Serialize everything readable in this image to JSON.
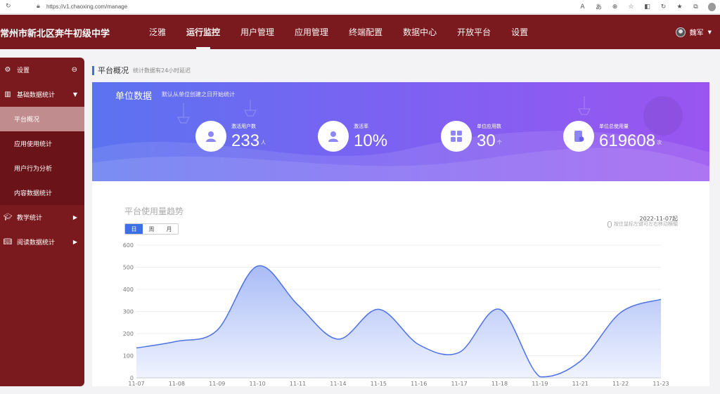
{
  "browser": {
    "url": "https://v1.chaoxing.com/manage",
    "avatar_initial": ""
  },
  "header": {
    "school_name": "常州市新北区奔牛初级中学",
    "nav": [
      "泛雅",
      "运行监控",
      "用户管理",
      "应用管理",
      "终端配置",
      "数据中心",
      "开放平台",
      "设置"
    ],
    "active_nav": "运行监控",
    "user_name": "魏军"
  },
  "sidebar": {
    "settings_label": "设置",
    "basic_stats_label": "基础数据统计",
    "sub_items": [
      "平台概况",
      "应用使用统计",
      "用户行为分析",
      "内容数据统计"
    ],
    "active_sub": "平台概况",
    "teaching_label": "教学统计",
    "reading_label": "阅读数据统计"
  },
  "page": {
    "title": "平台概况",
    "note": "统计数据有24小时延迟"
  },
  "banner": {
    "title": "单位数据",
    "subtitle": "默认从单位创建之日开始统计",
    "stats": [
      {
        "label": "激活用户数",
        "value": "233",
        "unit": "人",
        "icon": "user-icon"
      },
      {
        "label": "激活率",
        "value": "10%",
        "unit": "",
        "icon": "user-active-icon"
      },
      {
        "label": "单位应用数",
        "value": "30",
        "unit": "个",
        "icon": "apps-grid-icon"
      },
      {
        "label": "单位总使用量",
        "value": "619608",
        "unit": "次",
        "icon": "usage-document-icon"
      }
    ]
  },
  "chart": {
    "title": "平台使用量趋势",
    "tabs": [
      "日",
      "周",
      "月"
    ],
    "active_tab": "日",
    "date_label": "2022-11-07起",
    "hint": "按住鼠标左键可左右移动横轴"
  },
  "chart_data": {
    "type": "area",
    "x": [
      "11-07",
      "11-08",
      "11-09",
      "11-10",
      "11-11",
      "11-14",
      "11-15",
      "11-16",
      "11-17",
      "11-18",
      "11-19",
      "11-21",
      "11-22",
      "11-23"
    ],
    "values": [
      135,
      165,
      215,
      505,
      330,
      175,
      310,
      150,
      115,
      310,
      5,
      75,
      295,
      355
    ],
    "ylim": [
      0,
      600
    ],
    "yticks": [
      0,
      100,
      200,
      300,
      400,
      500,
      600
    ],
    "grid": true,
    "colors": {
      "line": "#4d72e8",
      "fill_top": "#9fb4f5",
      "fill_bottom": "#eef2ff"
    }
  }
}
